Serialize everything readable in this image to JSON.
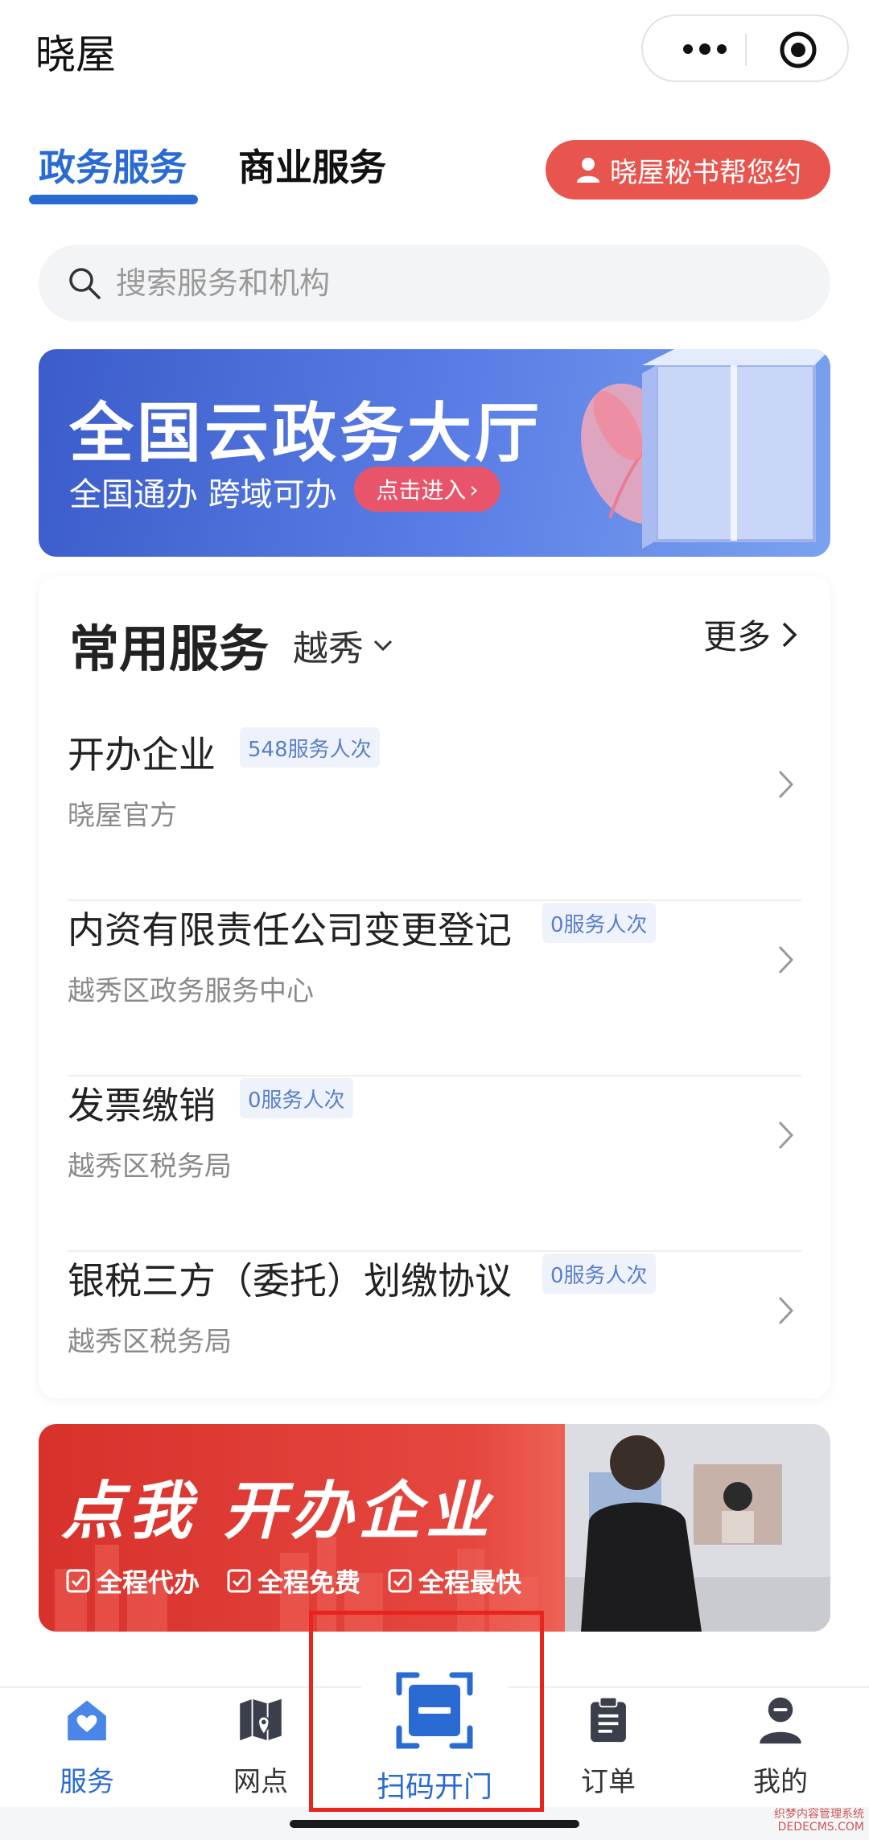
{
  "app": {
    "title": "晓屋",
    "more_icon": "more-dots-icon",
    "close_icon": "miniapp-close-icon"
  },
  "tabs": [
    {
      "label": "政务服务",
      "active": true
    },
    {
      "label": "商业服务",
      "active": false
    }
  ],
  "secretary_button": {
    "label": "晓屋秘书帮您约",
    "icon": "person-icon"
  },
  "search": {
    "placeholder": "搜索服务和机构",
    "value": ""
  },
  "banner_gov": {
    "title": "全国云政务大厅",
    "subtitle": "全国通办  跨域可办",
    "cta": "点击进入",
    "cta_suffix": "›"
  },
  "common_services": {
    "title": "常用服务",
    "location": "越秀",
    "more": "更多",
    "items": [
      {
        "name": "开办企业",
        "badge": "548服务人次",
        "org": "晓屋官方"
      },
      {
        "name": "内资有限责任公司变更登记",
        "badge": "0服务人次",
        "org": "越秀区政务服务中心"
      },
      {
        "name": "发票缴销",
        "badge": "0服务人次",
        "org": "越秀区税务局"
      },
      {
        "name": "银税三方（委托）划缴协议",
        "badge": "0服务人次",
        "org": "越秀区税务局"
      }
    ]
  },
  "banner_biz": {
    "title": "点我 开办企业",
    "features": [
      "全程代办",
      "全程免费",
      "全程最快"
    ]
  },
  "bottom_nav": [
    {
      "label": "服务",
      "icon": "home-service-icon",
      "active": true
    },
    {
      "label": "网点",
      "icon": "map-pin-icon",
      "active": false
    },
    {
      "label": "扫码开门",
      "icon": "scan-icon",
      "active": false
    },
    {
      "label": "订单",
      "icon": "clipboard-icon",
      "active": false
    },
    {
      "label": "我的",
      "icon": "user-icon",
      "active": false
    }
  ],
  "colors": {
    "primary": "#2a6bd3",
    "secretary_bg": "#e8554e",
    "highlight": "#e8241c"
  },
  "watermark": {
    "line1": "织梦内容管理系统",
    "line2": "DEDECMS.COM"
  }
}
